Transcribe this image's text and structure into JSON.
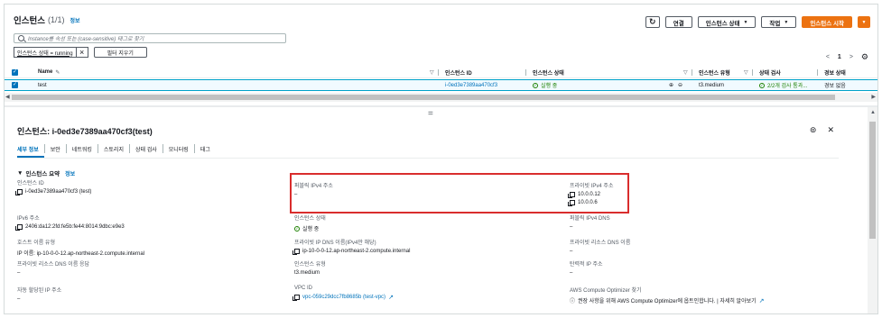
{
  "header": {
    "title": "인스턴스",
    "count": "(1/1)",
    "info": "정보",
    "refresh_icon": "refresh-icon",
    "connect": "연결",
    "instance_state": "인스턴스 상태",
    "actions": "작업",
    "launch": "인스턴스 시작"
  },
  "search": {
    "placeholder": "Instance를 속성 또는 (case-sensitive) 태그로 찾기"
  },
  "filters": {
    "token": "인스턴스 상태 = running",
    "clear": "필터 지우기"
  },
  "pager": {
    "prev": "<",
    "page": "1",
    "next": ">"
  },
  "table": {
    "columns": [
      "Name",
      "인스턴스 ID",
      "인스턴스 상태",
      "인스턴스 유형",
      "상태 검사",
      "경보 상태"
    ],
    "row": {
      "name": "test",
      "id": "i-0ed3e7389aa470cf3",
      "state": "실행 중",
      "type": "t3.medium",
      "check": "2/2개 검사 통과...",
      "alarm": "경보 없음"
    }
  },
  "detail": {
    "title": "인스턴스: i-0ed3e7389aa470cf3(test)",
    "tabs": [
      "세부 정보",
      "보안",
      "네트워킹",
      "스토리지",
      "상태 검사",
      "모니터링",
      "태그"
    ],
    "summary": "인스턴스 요약",
    "summary_info": "정보",
    "fields": {
      "instance_id_label": "인스턴스 ID",
      "instance_id": "i-0ed3e7389aa470cf3 (test)",
      "public_ipv4_label": "퍼블릭 IPv4 주소",
      "public_ipv4": "–",
      "private_ipv4_label": "프라이빗 IPv4 주소",
      "private_ipv4_1": "10.0.0.12",
      "private_ipv4_2": "10.0.0.6",
      "ipv6_label": "IPv6 주소",
      "ipv6": "2406:da12:2fd:fe5b:fe44:8014:9dbc:e9e3",
      "state_label": "인스턴스 상태",
      "state": "실행 중",
      "public_dns_label": "퍼블릭 IPv4 DNS",
      "public_dns": "–",
      "hostname_type_label": "호스트 이름 유형",
      "hostname_type": "IP 이름: ip-10-0-0-12.ap-northeast-2.compute.internal",
      "private_dns_label": "프라이빗 IP DNS 이름(IPv4만 해당)",
      "private_dns": "ip-10-0-0-12.ap-northeast-2.compute.internal",
      "private_resource_dns_label": "프라이빗 리소스 DNS 이름",
      "private_resource_dns": "–",
      "answer_private_dns_label": "프라이빗 리소스 DNS 이름 응답",
      "answer_private_dns": "–",
      "instance_type_label": "인스턴스 유형",
      "instance_type": "t3.medium",
      "elastic_ip_label": "탄력적 IP 주소",
      "elastic_ip": "–",
      "auto_ip_label": "자동 할당된 IP 주소",
      "auto_ip": "–",
      "vpc_label": "VPC ID",
      "vpc": "vpc-059c29dcc7fb8685b (test-vpc)",
      "optimizer_label": "AWS Compute Optimizer 찾기",
      "optimizer": "권장 사항을 위해 AWS Compute Optimizer에 옵트인합니다. | 자세히 알아보기"
    }
  },
  "colors": {
    "accent": "#0073bb",
    "primary": "#ec7211",
    "highlight": "#d92d2d",
    "success": "#1d8102"
  }
}
